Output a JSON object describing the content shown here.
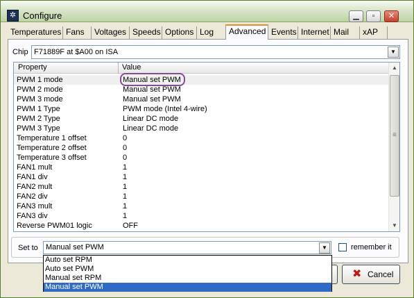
{
  "window": {
    "title": "Configure",
    "icon": "app-fan-icon"
  },
  "titlebar_buttons": [
    "minimize",
    "maximize",
    "close"
  ],
  "tabs": [
    {
      "label": "Temperatures"
    },
    {
      "label": "Fans"
    },
    {
      "label": "Voltages"
    },
    {
      "label": "Speeds"
    },
    {
      "label": "Options"
    },
    {
      "label": "Log"
    },
    {
      "label": "Advanced",
      "active": true
    },
    {
      "label": "Events"
    },
    {
      "label": "Internet"
    },
    {
      "label": "Mail"
    },
    {
      "label": "xAP"
    }
  ],
  "chip": {
    "label": "Chip",
    "value": "F71889F at $A00 on ISA"
  },
  "table": {
    "columns": [
      "Property",
      "Value"
    ],
    "rows": [
      {
        "property": "PWM 1 mode",
        "value": "Manual set PWM"
      },
      {
        "property": "PWM 2 mode",
        "value": "Manual set PWM"
      },
      {
        "property": "PWM 3 mode",
        "value": "Manual set PWM"
      },
      {
        "property": "PWM 1 Type",
        "value": "PWM mode (Intel 4-wire)"
      },
      {
        "property": "PWM 2 Type",
        "value": "Linear DC mode"
      },
      {
        "property": "PWM 3 Type",
        "value": "Linear DC mode"
      },
      {
        "property": "Temperature 1 offset",
        "value": "0"
      },
      {
        "property": "Temperature 2 offset",
        "value": "0"
      },
      {
        "property": "Temperature 3 offset",
        "value": "0"
      },
      {
        "property": "FAN1 mult",
        "value": "1"
      },
      {
        "property": "FAN1 div",
        "value": "1"
      },
      {
        "property": "FAN2 mult",
        "value": "1"
      },
      {
        "property": "FAN2 div",
        "value": "1"
      },
      {
        "property": "FAN3 mult",
        "value": "1"
      },
      {
        "property": "FAN3 div",
        "value": "1"
      },
      {
        "property": "Reverse PWM01 logic",
        "value": "OFF"
      }
    ]
  },
  "set_to": {
    "label": "Set to",
    "value": "Manual set PWM"
  },
  "remember": {
    "label": "remember it",
    "checked": false
  },
  "dropdown_options": [
    "Auto set RPM",
    "Auto set PWM",
    "Manual set RPM",
    "Manual set PWM"
  ],
  "dropdown_selected": "Manual set PWM",
  "buttons": {
    "cancel": "Cancel"
  },
  "colors": {
    "selection": "#316ac5",
    "active_tab_accent": "#e68b2c",
    "annotation_ring": "#8a4a9a"
  }
}
